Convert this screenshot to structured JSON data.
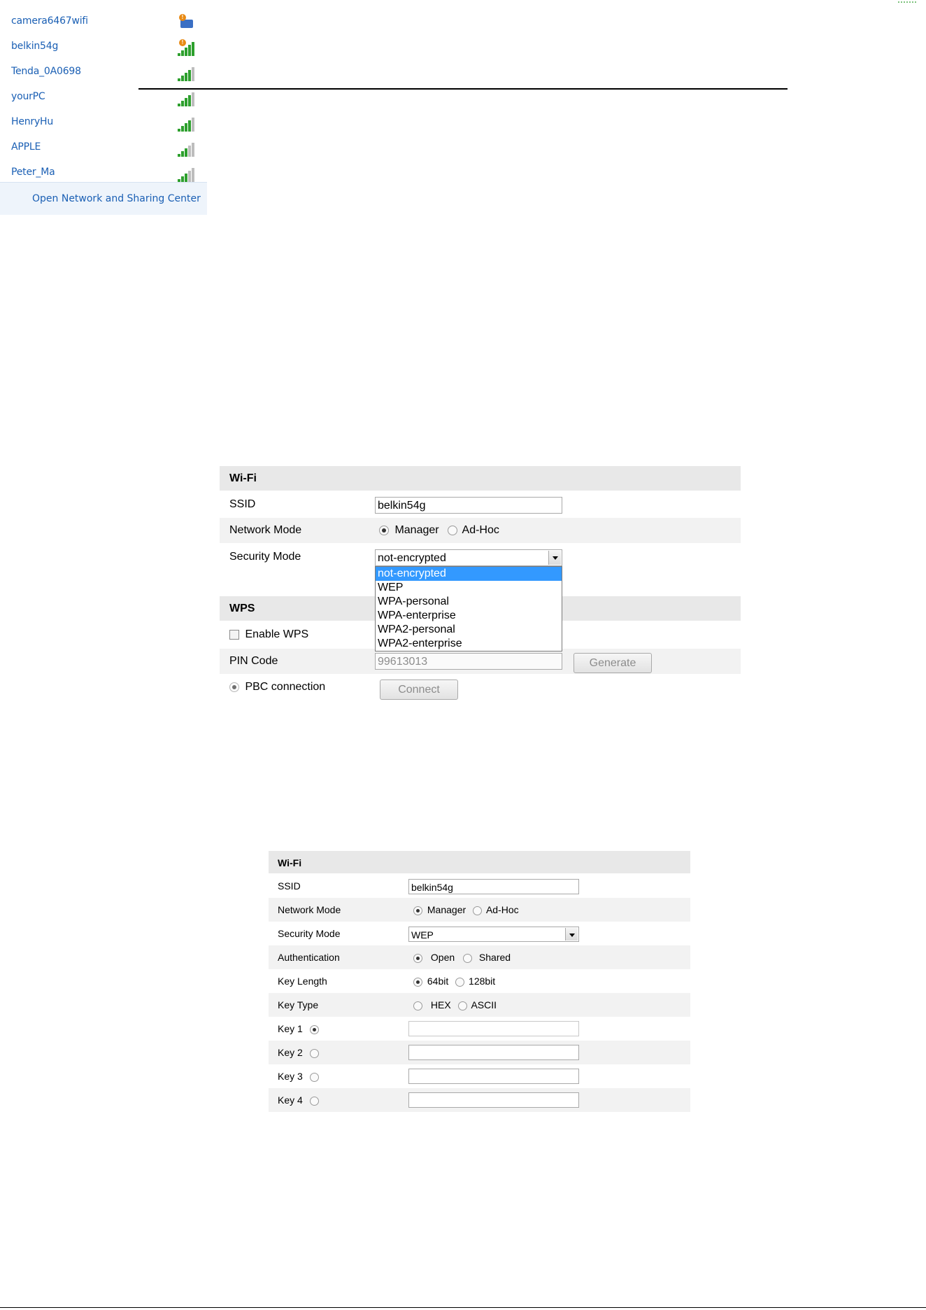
{
  "network_list": {
    "networks": [
      {
        "name": "camera6467wifi",
        "signal": 1,
        "secured": true
      },
      {
        "name": "belkin54g",
        "signal": 5,
        "secured": true
      },
      {
        "name": "Tenda_0A0698",
        "signal": 4,
        "secured": false
      },
      {
        "name": "yourPC",
        "signal": 4,
        "secured": false
      },
      {
        "name": "HenryHu",
        "signal": 4,
        "secured": false
      },
      {
        "name": "APPLE",
        "signal": 3,
        "secured": false
      },
      {
        "name": "Peter_Ma",
        "signal": 3,
        "secured": false
      }
    ],
    "footer_link": "Open Network and Sharing Center",
    "link_color": "#1a5fb4",
    "signal_color": "#2ea02e"
  },
  "wifi_form_1": {
    "wifi_header": "Wi-Fi",
    "ssid_label": "SSID",
    "ssid_value": "belkin54g",
    "network_mode_label": "Network Mode",
    "mode_manager": "Manager",
    "mode_adhoc": "Ad-Hoc",
    "security_mode_label": "Security Mode",
    "security_value": "not-encrypted",
    "security_options": [
      "not-encrypted",
      "WEP",
      "WPA-personal",
      "WPA-enterprise",
      "WPA2-personal",
      "WPA2-enterprise"
    ],
    "wps_header": "WPS",
    "enable_wps_label": "Enable WPS",
    "pin_code_label": "PIN Code",
    "pin_code_value": "99613013",
    "generate_label": "Generate",
    "pbc_label": "PBC connection",
    "connect_label": "Connect",
    "selected_option_color": "#3399ff"
  },
  "wifi_form_2": {
    "wifi_header": "Wi-Fi",
    "ssid_label": "SSID",
    "ssid_value": "belkin54g",
    "network_mode_label": "Network Mode",
    "mode_manager": "Manager",
    "mode_adhoc": "Ad-Hoc",
    "security_mode_label": "Security Mode",
    "security_value": "WEP",
    "authentication_label": "Authentication",
    "auth_open": "Open",
    "auth_shared": "Shared",
    "key_length_label": "Key Length",
    "len_64": "64bit",
    "len_128": "128bit",
    "key_type_label": "Key Type",
    "type_hex": "HEX",
    "type_ascii": "ASCII",
    "keys": [
      "Key 1",
      "Key 2",
      "Key 3",
      "Key 4"
    ]
  }
}
